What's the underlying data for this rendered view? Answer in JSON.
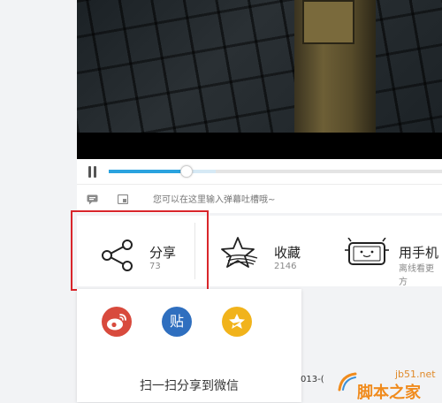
{
  "player": {
    "progress_percent": 23,
    "buffered_percent": 32
  },
  "danmaku": {
    "placeholder": "您可以在这里输入弹幕吐槽哦~"
  },
  "actions": {
    "share": {
      "label": "分享",
      "count": "73"
    },
    "favorite": {
      "label": "收藏",
      "count": "2146"
    },
    "mobile": {
      "label": "用手机",
      "sub": "离线看更方"
    }
  },
  "share_menu": {
    "tieba_label": "贴",
    "wechat_text": "扫一扫分享到微信"
  },
  "page": {
    "partial_date": "013-("
  },
  "watermark": {
    "site": "jb51.net",
    "name": "脚本之家"
  },
  "colors": {
    "highlight": "#d9262b",
    "progress": "#2aa3df",
    "weibo": "#d84a3d",
    "tieba": "#2f6fbf",
    "qzone": "#f1b31b"
  }
}
